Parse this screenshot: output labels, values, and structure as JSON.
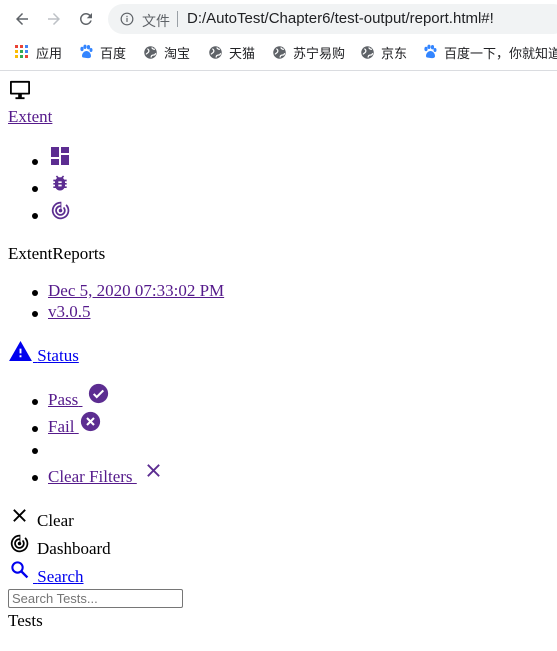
{
  "browser": {
    "scheme_label": "文件",
    "url": "D:/AutoTest/Chapter6/test-output/report.html#!",
    "bookmarks": [
      {
        "label": "应用",
        "icon": "apps-grid-icon"
      },
      {
        "label": "百度",
        "icon": "baidu-paw-icon"
      },
      {
        "label": "淘宝",
        "icon": "globe-icon"
      },
      {
        "label": "天猫",
        "icon": "globe-icon"
      },
      {
        "label": "苏宁易购",
        "icon": "globe-icon"
      },
      {
        "label": "京东",
        "icon": "globe-icon"
      },
      {
        "label": "百度一下，你就知道",
        "icon": "baidu-paw-icon"
      }
    ]
  },
  "report": {
    "logo_icon": "desktop-icon",
    "brand_link": "Extent",
    "nav_icons": [
      "dashboard-icon",
      "bug-icon",
      "track-changes-icon"
    ],
    "title": "ExtentReports",
    "meta": {
      "date": "Dec 5, 2020 07:33:02 PM",
      "version": "v3.0.5"
    },
    "status": {
      "label": "Status",
      "filters": [
        {
          "label": "Pass",
          "icon": "check-circle-icon"
        },
        {
          "label": "Fail",
          "icon": "cancel-circle-icon"
        },
        {
          "label": ""
        },
        {
          "label": "Clear Filters",
          "icon": "close-icon"
        }
      ]
    },
    "clear_label": "Clear",
    "dashboard_label": "Dashboard",
    "search_label": "Search",
    "search_placeholder": "Search Tests...",
    "tests_label": "Tests"
  },
  "colors": {
    "link_visited": "#551a8b",
    "link_blue": "#0000ee",
    "accent_purple": "#5c2d91"
  }
}
